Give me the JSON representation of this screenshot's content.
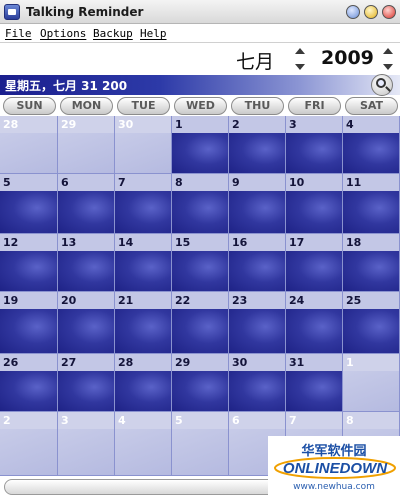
{
  "window": {
    "title": "Talking Reminder",
    "controls": {
      "minimize": "",
      "maximize": "",
      "close": ""
    }
  },
  "menu": [
    "File",
    "Options",
    "Backup",
    "Help"
  ],
  "navigator": {
    "month": "七月",
    "year": "2009"
  },
  "date_banner": "星期五，七月 31 200",
  "weekdays": [
    "SUN",
    "MON",
    "TUE",
    "WED",
    "THU",
    "FRI",
    "SAT"
  ],
  "weeks": [
    [
      {
        "d": "28",
        "other": true
      },
      {
        "d": "29",
        "other": true
      },
      {
        "d": "30",
        "other": true
      },
      {
        "d": "1"
      },
      {
        "d": "2"
      },
      {
        "d": "3"
      },
      {
        "d": "4"
      }
    ],
    [
      {
        "d": "5"
      },
      {
        "d": "6"
      },
      {
        "d": "7"
      },
      {
        "d": "8"
      },
      {
        "d": "9"
      },
      {
        "d": "10"
      },
      {
        "d": "11"
      }
    ],
    [
      {
        "d": "12"
      },
      {
        "d": "13"
      },
      {
        "d": "14"
      },
      {
        "d": "15"
      },
      {
        "d": "16"
      },
      {
        "d": "17"
      },
      {
        "d": "18"
      }
    ],
    [
      {
        "d": "19"
      },
      {
        "d": "20"
      },
      {
        "d": "21"
      },
      {
        "d": "22"
      },
      {
        "d": "23"
      },
      {
        "d": "24"
      },
      {
        "d": "25"
      }
    ],
    [
      {
        "d": "26"
      },
      {
        "d": "27"
      },
      {
        "d": "28"
      },
      {
        "d": "29"
      },
      {
        "d": "30"
      },
      {
        "d": "31"
      },
      {
        "d": "1",
        "other": true
      }
    ],
    [
      {
        "d": "2",
        "other": true
      },
      {
        "d": "3",
        "other": true
      },
      {
        "d": "4",
        "other": true
      },
      {
        "d": "5",
        "other": true
      },
      {
        "d": "6",
        "other": true
      },
      {
        "d": "7",
        "other": true
      },
      {
        "d": "8",
        "other": true
      }
    ]
  ],
  "watermark": {
    "chinese": "华军软件园",
    "logo": "ONLINEDOWN",
    "url": "www.newhua.com"
  },
  "colors": {
    "accent": "#1e2286",
    "banner": "#1b1f8e"
  }
}
